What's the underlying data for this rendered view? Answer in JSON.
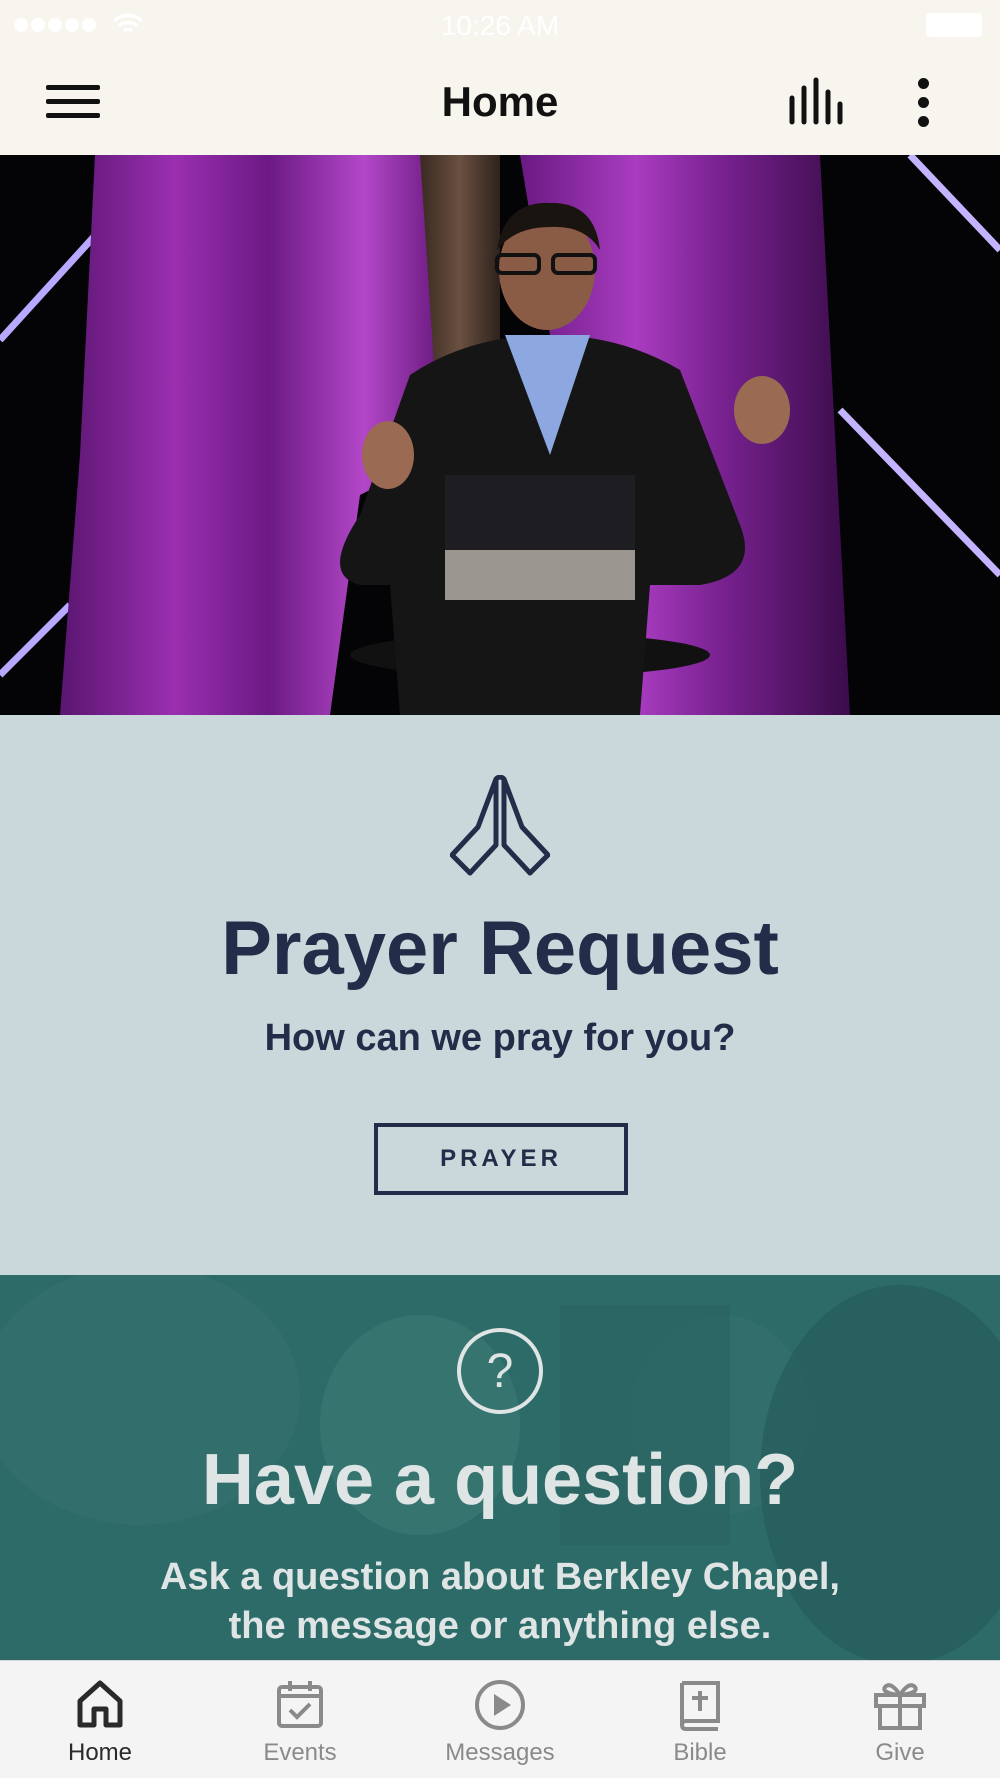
{
  "status_bar": {
    "time": "10:26 AM"
  },
  "header": {
    "title": "Home"
  },
  "prayer": {
    "title": "Prayer Request",
    "subtitle": "How can we pray for you?",
    "button_label": "PRAYER"
  },
  "question": {
    "title": "Have a question?",
    "subtitle_line1": "Ask a question about Berkley Chapel,",
    "subtitle_line2": "the message or anything else."
  },
  "tab_bar": {
    "active": "Home",
    "tabs": [
      {
        "label": "Home",
        "icon": "home-icon"
      },
      {
        "label": "Events",
        "icon": "calendar-check-icon"
      },
      {
        "label": "Messages",
        "icon": "play-circle-icon"
      },
      {
        "label": "Bible",
        "icon": "bible-icon"
      },
      {
        "label": "Give",
        "icon": "gift-icon"
      }
    ]
  },
  "colors": {
    "header_bg": "#f8f5ef",
    "prayer_bg": "#cbd8db",
    "prayer_text": "#232c48",
    "question_bg": "#2d6b69",
    "question_text": "#dfe5e4",
    "tab_bar_bg": "#f4f4f4"
  }
}
